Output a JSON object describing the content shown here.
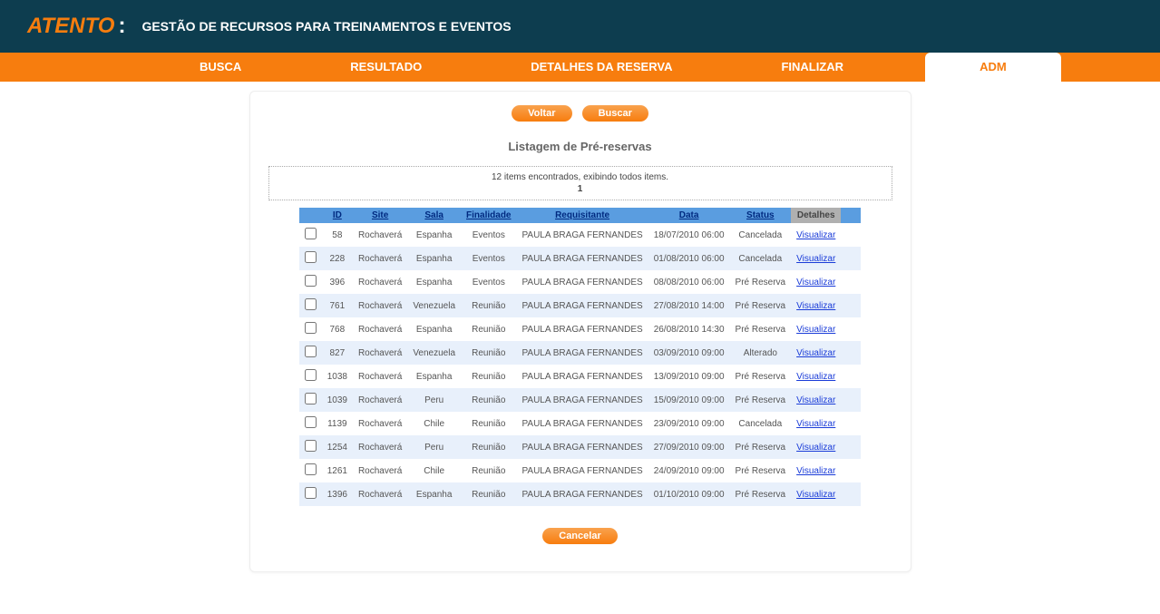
{
  "header": {
    "logo_text": "ATENTO",
    "logo_colon": ":",
    "title": "GESTÃO DE RECURSOS PARA TREINAMENTOS E EVENTOS"
  },
  "nav": {
    "tabs": [
      {
        "label": "BUSCA",
        "active": false
      },
      {
        "label": "RESULTADO",
        "active": false
      },
      {
        "label": "DETALHES DA RESERVA",
        "active": false
      },
      {
        "label": "FINALIZAR",
        "active": false
      },
      {
        "label": "ADM",
        "active": true
      }
    ]
  },
  "buttons": {
    "voltar": "Voltar",
    "buscar": "Buscar",
    "cancelar": "Cancelar"
  },
  "list_title": "Listagem de Pré-reservas",
  "summary": {
    "text": "12 items encontrados, exibindo todos items.",
    "page": "1"
  },
  "columns": {
    "id": "ID",
    "site": "Site",
    "sala": "Sala",
    "finalidade": "Finalidade",
    "requisitante": "Requisitante",
    "data": "Data",
    "status": "Status",
    "detalhes": "Detalhes"
  },
  "view_link_label": "Visualizar",
  "rows": [
    {
      "id": "58",
      "site": "Rochaverá",
      "sala": "Espanha",
      "finalidade": "Eventos",
      "requisitante": "PAULA BRAGA FERNANDES",
      "data": "18/07/2010 06:00",
      "status": "Cancelada"
    },
    {
      "id": "228",
      "site": "Rochaverá",
      "sala": "Espanha",
      "finalidade": "Eventos",
      "requisitante": "PAULA BRAGA FERNANDES",
      "data": "01/08/2010 06:00",
      "status": "Cancelada"
    },
    {
      "id": "396",
      "site": "Rochaverá",
      "sala": "Espanha",
      "finalidade": "Eventos",
      "requisitante": "PAULA BRAGA FERNANDES",
      "data": "08/08/2010 06:00",
      "status": "Pré Reserva"
    },
    {
      "id": "761",
      "site": "Rochaverá",
      "sala": "Venezuela",
      "finalidade": "Reunião",
      "requisitante": "PAULA BRAGA FERNANDES",
      "data": "27/08/2010 14:00",
      "status": "Pré Reserva"
    },
    {
      "id": "768",
      "site": "Rochaverá",
      "sala": "Espanha",
      "finalidade": "Reunião",
      "requisitante": "PAULA BRAGA FERNANDES",
      "data": "26/08/2010 14:30",
      "status": "Pré Reserva"
    },
    {
      "id": "827",
      "site": "Rochaverá",
      "sala": "Venezuela",
      "finalidade": "Reunião",
      "requisitante": "PAULA BRAGA FERNANDES",
      "data": "03/09/2010 09:00",
      "status": "Alterado"
    },
    {
      "id": "1038",
      "site": "Rochaverá",
      "sala": "Espanha",
      "finalidade": "Reunião",
      "requisitante": "PAULA BRAGA FERNANDES",
      "data": "13/09/2010 09:00",
      "status": "Pré Reserva"
    },
    {
      "id": "1039",
      "site": "Rochaverá",
      "sala": "Peru",
      "finalidade": "Reunião",
      "requisitante": "PAULA BRAGA FERNANDES",
      "data": "15/09/2010 09:00",
      "status": "Pré Reserva"
    },
    {
      "id": "1139",
      "site": "Rochaverá",
      "sala": "Chile",
      "finalidade": "Reunião",
      "requisitante": "PAULA BRAGA FERNANDES",
      "data": "23/09/2010 09:00",
      "status": "Cancelada"
    },
    {
      "id": "1254",
      "site": "Rochaverá",
      "sala": "Peru",
      "finalidade": "Reunião",
      "requisitante": "PAULA BRAGA FERNANDES",
      "data": "27/09/2010 09:00",
      "status": "Pré Reserva"
    },
    {
      "id": "1261",
      "site": "Rochaverá",
      "sala": "Chile",
      "finalidade": "Reunião",
      "requisitante": "PAULA BRAGA FERNANDES",
      "data": "24/09/2010 09:00",
      "status": "Pré Reserva"
    },
    {
      "id": "1396",
      "site": "Rochaverá",
      "sala": "Espanha",
      "finalidade": "Reunião",
      "requisitante": "PAULA BRAGA FERNANDES",
      "data": "01/10/2010 09:00",
      "status": "Pré Reserva"
    }
  ]
}
